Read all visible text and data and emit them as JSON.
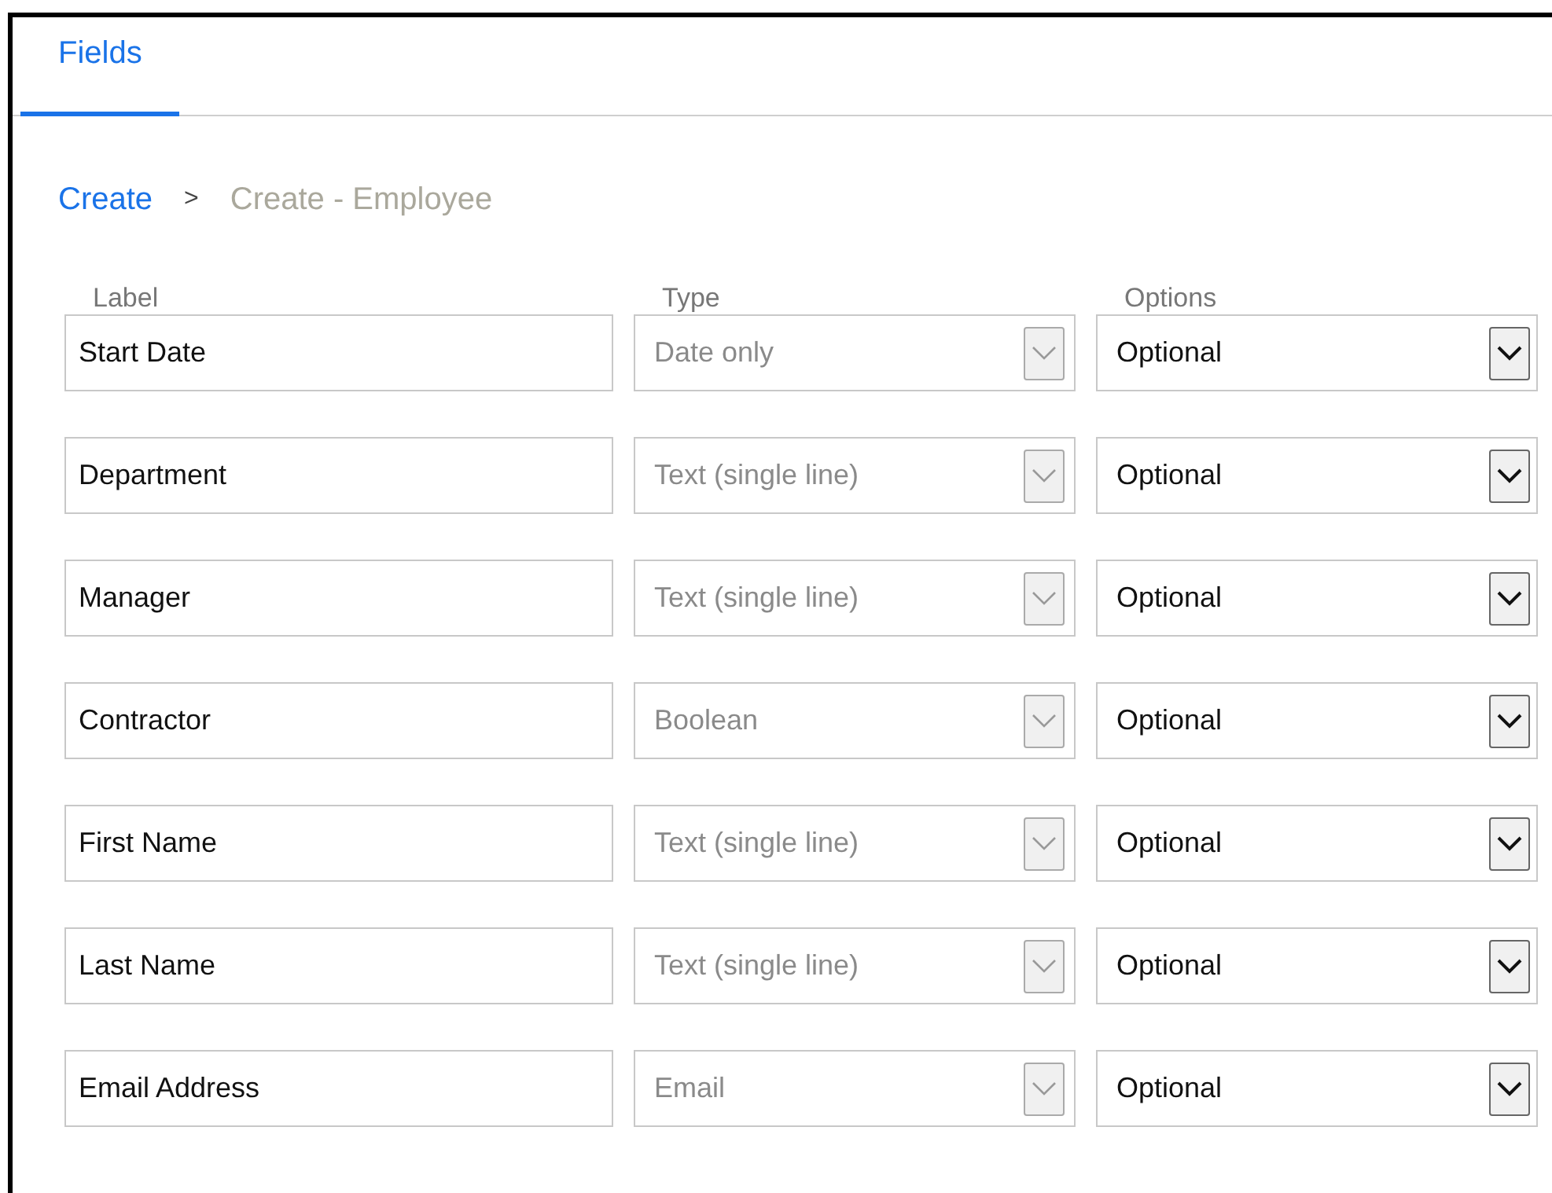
{
  "tabs": [
    {
      "label": "Fields",
      "selected": true
    }
  ],
  "breadcrumb": [
    {
      "label": "Create",
      "current": false
    },
    {
      "label": "Create - Employee",
      "current": true
    }
  ],
  "breadcrumb_separator": ">",
  "columns": [
    "Label",
    "Type",
    "Options"
  ],
  "rows": [
    {
      "label": "Start Date",
      "type": "Date only",
      "type_disabled": true,
      "option": "Optional"
    },
    {
      "label": "Department",
      "type": "Text (single line)",
      "type_disabled": true,
      "option": "Optional"
    },
    {
      "label": "Manager",
      "type": "Text (single line)",
      "type_disabled": true,
      "option": "Optional"
    },
    {
      "label": "Contractor",
      "type": "Boolean",
      "type_disabled": true,
      "option": "Optional"
    },
    {
      "label": "First Name",
      "type": "Text (single line)",
      "type_disabled": true,
      "option": "Optional"
    },
    {
      "label": "Last Name",
      "type": "Text (single line)",
      "type_disabled": true,
      "option": "Optional"
    },
    {
      "label": "Email Address",
      "type": "Email",
      "type_disabled": true,
      "option": "Optional"
    }
  ]
}
